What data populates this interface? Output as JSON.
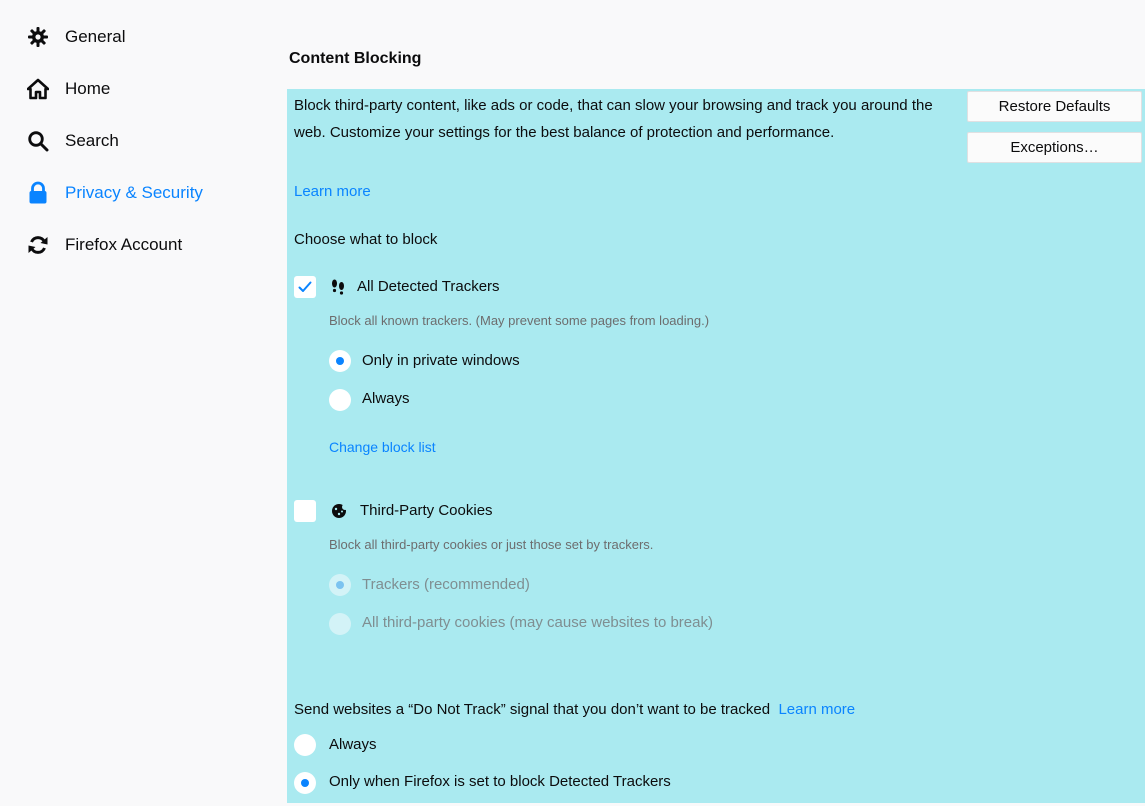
{
  "sidebar": {
    "items": [
      {
        "label": "General",
        "icon": "gear-icon",
        "selected": false
      },
      {
        "label": "Home",
        "icon": "home-icon",
        "selected": false
      },
      {
        "label": "Search",
        "icon": "search-icon",
        "selected": false
      },
      {
        "label": "Privacy & Security",
        "icon": "lock-icon",
        "selected": true
      },
      {
        "label": "Firefox Account",
        "icon": "sync-icon",
        "selected": false
      }
    ]
  },
  "content_blocking": {
    "title": "Content Blocking",
    "description": "Block third-party content, like ads or code, that can slow your browsing and track you around the web. Customize your settings for the best balance of protection and performance.",
    "learn_more": "Learn more",
    "restore_defaults": "Restore Defaults",
    "exceptions": "Exceptions…",
    "choose_label": "Choose what to block",
    "trackers": {
      "label": "All Detected Trackers",
      "icon": "footprints-icon",
      "checked": true,
      "description": "Block all known trackers. (May prevent some pages from loading.)",
      "options": [
        {
          "label": "Only in private windows",
          "selected": true
        },
        {
          "label": "Always",
          "selected": false
        }
      ],
      "change_block_list": "Change block list"
    },
    "cookies": {
      "label": "Third-Party Cookies",
      "icon": "cookie-icon",
      "checked": false,
      "description": "Block all third-party cookies or just those set by trackers.",
      "options": [
        {
          "label": "Trackers (recommended)",
          "selected": true,
          "disabled": true
        },
        {
          "label": "All third-party cookies (may cause websites to break)",
          "selected": false,
          "disabled": true
        }
      ]
    }
  },
  "do_not_track": {
    "label": "Send websites a “Do Not Track” signal that you don’t want to be tracked",
    "learn_more": "Learn more",
    "options": [
      {
        "label": "Always",
        "selected": false
      },
      {
        "label": "Only when Firefox is set to block Detected Trackers",
        "selected": true
      }
    ]
  },
  "colors": {
    "accent": "#0a84ff",
    "panel_highlight": "#aaeaf0",
    "background": "#f9f9fa"
  }
}
